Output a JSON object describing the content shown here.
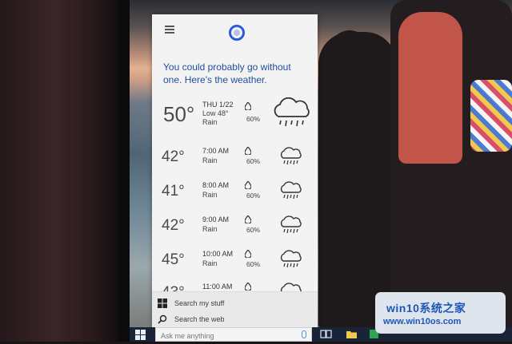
{
  "cortana": {
    "headline": "You could probably go without one. Here's the weather.",
    "today": {
      "temp": "50°",
      "day": "THU 1/22",
      "low": "Low 48°",
      "condition": "Rain",
      "precip": "60%",
      "icon": "rain-cloud-icon"
    },
    "hours": [
      {
        "temp": "42°",
        "time": "7:00 AM",
        "condition": "Rain",
        "precip": "60%",
        "icon": "rain-cloud-icon"
      },
      {
        "temp": "41°",
        "time": "8:00 AM",
        "condition": "Rain",
        "precip": "60%",
        "icon": "rain-cloud-icon"
      },
      {
        "temp": "42°",
        "time": "9:00 AM",
        "condition": "Rain",
        "precip": "60%",
        "icon": "rain-cloud-icon"
      },
      {
        "temp": "45°",
        "time": "10:00 AM",
        "condition": "Rain",
        "precip": "60%",
        "icon": "rain-cloud-icon"
      },
      {
        "temp": "43°",
        "time": "11:00 AM",
        "condition": "",
        "precip": "",
        "icon": "rain-cloud-icon"
      }
    ],
    "footer": {
      "search_stuff": "Search my stuff",
      "search_web": "Search the web"
    }
  },
  "taskbar": {
    "search_placeholder": "Ask me anything"
  },
  "watermark": {
    "title": "win10系统之家",
    "url": "www.win10os.com"
  },
  "colors": {
    "accent": "#2b5bd8",
    "headline": "#1f4f9a",
    "taskbar": "#1a2438"
  }
}
